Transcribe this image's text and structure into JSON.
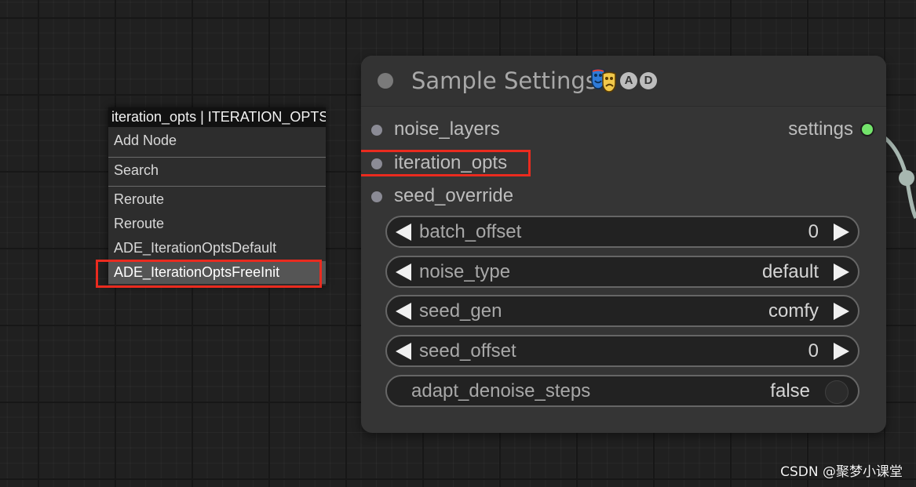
{
  "colors": {
    "canvas_background": "#202020",
    "node_body": "#353535",
    "slot_input_dot": "#8b8b95",
    "output_dot": "#73e36b",
    "highlight_box": "#ea2b1f",
    "menu_header": "#111111",
    "menu_background": "#2d2d2d",
    "menu_active_item": "#555555"
  },
  "node": {
    "title": "Sample Settings",
    "title_icon": "theater-masks-icon",
    "badges": [
      "A",
      "D"
    ],
    "inputs": [
      {
        "label": "noise_layers"
      },
      {
        "label": "iteration_opts"
      },
      {
        "label": "seed_override"
      }
    ],
    "output": {
      "label": "settings"
    },
    "widgets": [
      {
        "label": "batch_offset",
        "value": "0"
      },
      {
        "label": "noise_type",
        "value": "default"
      },
      {
        "label": "seed_gen",
        "value": "comfy"
      },
      {
        "label": "seed_offset",
        "value": "0"
      }
    ],
    "toggle": {
      "label": "adapt_denoise_steps",
      "value": "false"
    }
  },
  "context_menu": {
    "header": "iteration_opts | ITERATION_OPTS",
    "items": [
      {
        "label": "Add Node"
      },
      {
        "label": "Search"
      },
      {
        "label": "Reroute"
      },
      {
        "label": "Reroute"
      },
      {
        "label": "ADE_IterationOptsDefault"
      },
      {
        "label": "ADE_IterationOptsFreeInit"
      }
    ]
  },
  "watermark": "CSDN @聚梦小课堂"
}
